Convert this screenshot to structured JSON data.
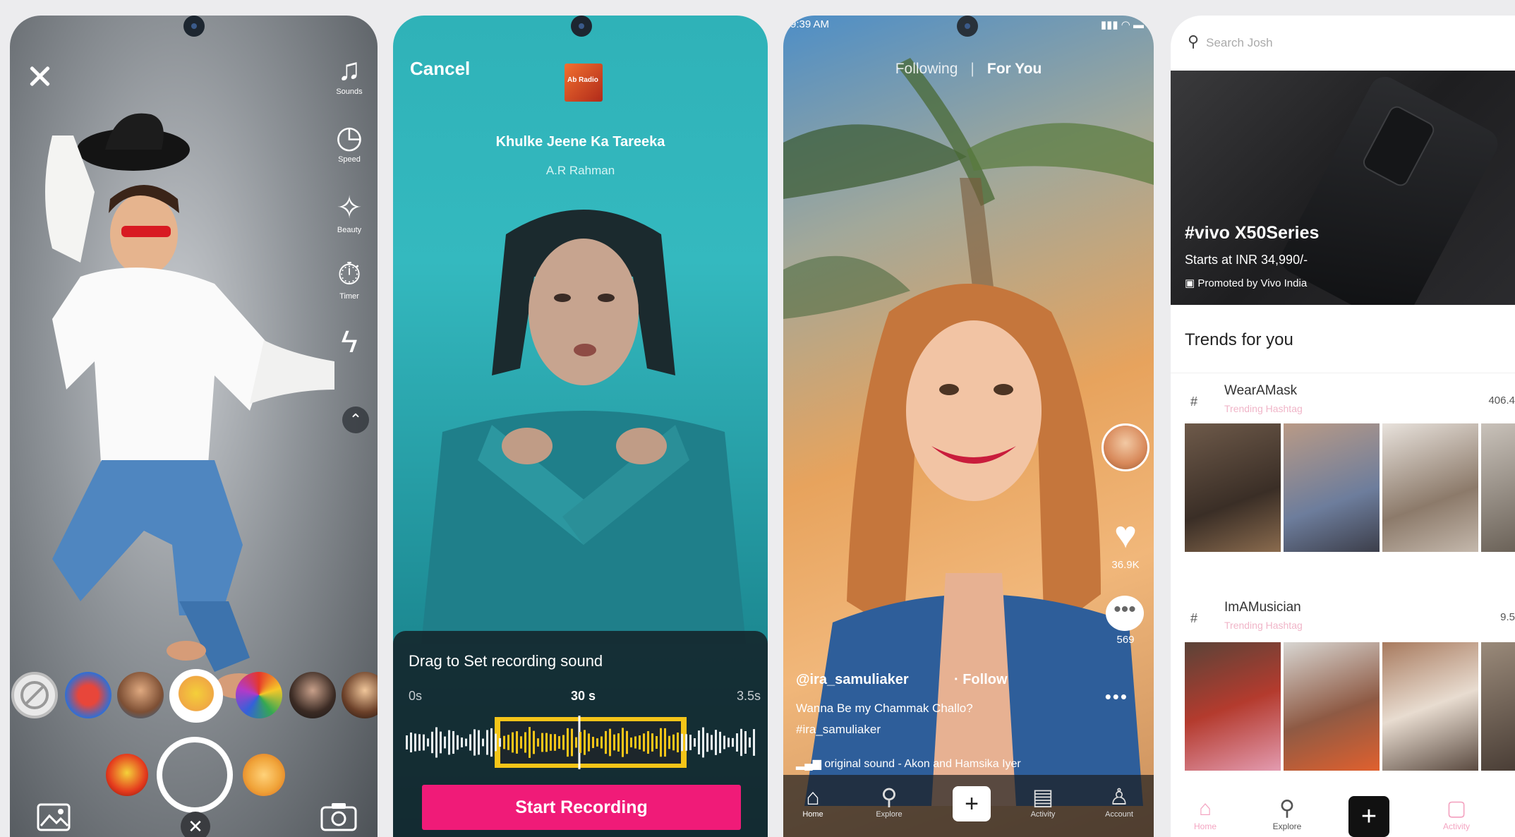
{
  "camera": {
    "tools": [
      {
        "icon": "music-note-icon",
        "label": "Sounds"
      },
      {
        "icon": "speed-icon",
        "label": "Speed"
      },
      {
        "icon": "beauty-wand-icon",
        "label": "Beauty"
      },
      {
        "icon": "timer-icon",
        "label": "Timer"
      },
      {
        "icon": "flash-off-icon",
        "label": ""
      }
    ]
  },
  "recording": {
    "cancel": "Cancel",
    "album_art_text": "Ab Radio",
    "song_title": "Khulke Jeene Ka Tareeka",
    "artist": "A.R Rahman",
    "panel_title": "Drag to Set recording sound",
    "ticks": {
      "start": "0s",
      "mid": "30 s",
      "end": "3.5s"
    },
    "start_button": "Start Recording"
  },
  "feed": {
    "status_time": "9:39 AM",
    "tabs": {
      "following": "Following",
      "separator": "|",
      "foryou": "For You"
    },
    "likes": "36.9K",
    "comments": "569",
    "username": "@ira_samuliaker",
    "follow": "· Follow",
    "caption": "Wanna Be my Chammak Challo?",
    "hashtag": "#ira_samuliaker",
    "sound": "original sound - Akon and Hamsika Iyer",
    "nav": [
      {
        "icon": "home-icon",
        "label": "Home"
      },
      {
        "icon": "explore-icon",
        "label": "Explore"
      },
      {
        "icon": "add-icon",
        "label": ""
      },
      {
        "icon": "activity-icon",
        "label": "Activity"
      },
      {
        "icon": "account-icon",
        "label": "Account"
      }
    ]
  },
  "explore": {
    "search_placeholder": "Search Josh",
    "banner": {
      "title": "#vivo X50Series",
      "subtitle": "Starts at INR 34,990/-",
      "promoted": "Promoted by Vivo India"
    },
    "trends_title": "Trends for you",
    "trends": [
      {
        "hash": "#",
        "name": "WearAMask",
        "sub": "Trending Hashtag",
        "count": "406.4"
      },
      {
        "hash": "#",
        "name": "ImAMusician",
        "sub": "Trending Hashtag",
        "count": "9.5"
      }
    ],
    "nav": [
      {
        "icon": "home-icon",
        "label": "Home"
      },
      {
        "icon": "explore-icon",
        "label": "Explore"
      },
      {
        "icon": "add-icon",
        "label": ""
      },
      {
        "icon": "activity-icon",
        "label": "Activity"
      }
    ]
  }
}
